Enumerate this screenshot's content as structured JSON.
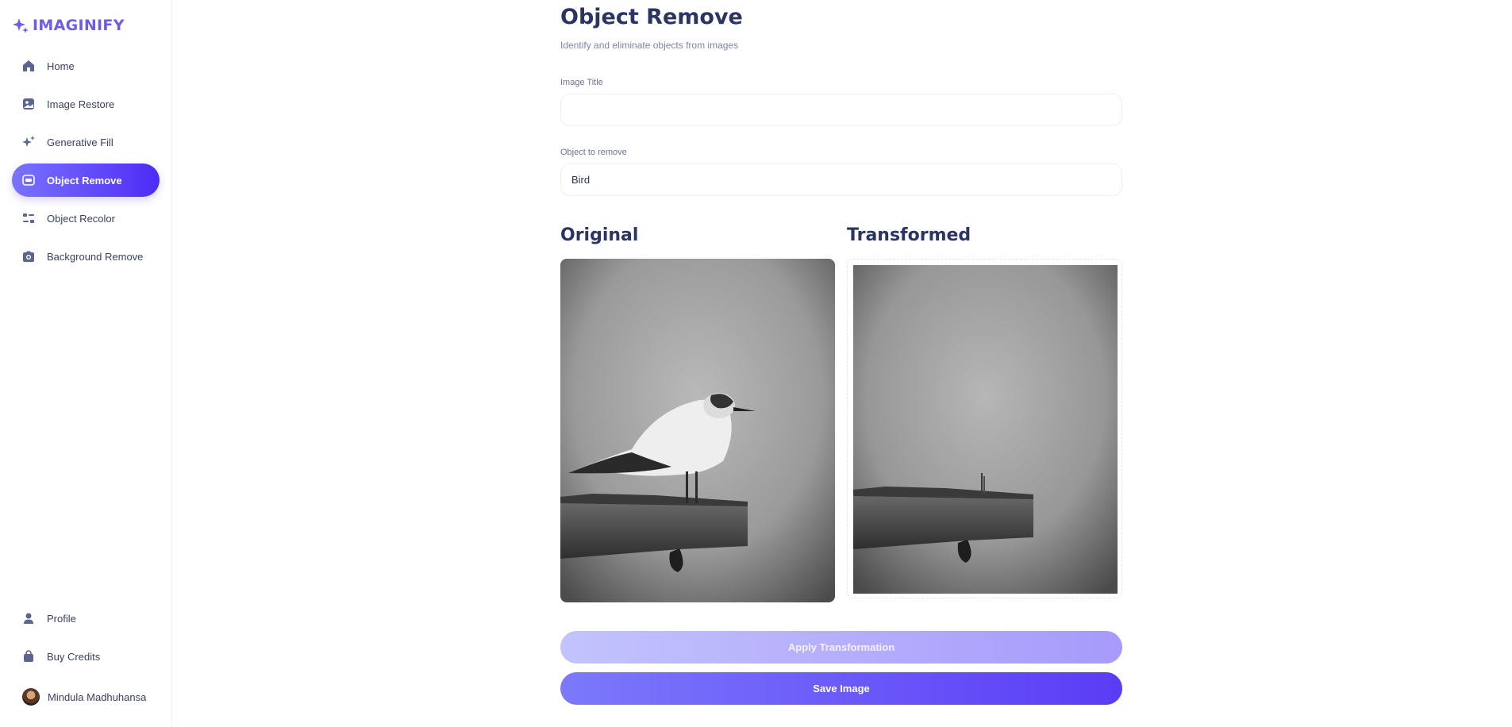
{
  "app": {
    "name": "IMAGINIFY",
    "brand_color": "#6c5ce7"
  },
  "sidebar": {
    "items": [
      {
        "label": "Home",
        "icon": "home-icon"
      },
      {
        "label": "Image Restore",
        "icon": "image-icon"
      },
      {
        "label": "Generative Fill",
        "icon": "sparkles-icon"
      },
      {
        "label": "Object Remove",
        "icon": "scan-icon",
        "active": true
      },
      {
        "label": "Object Recolor",
        "icon": "filter-icon"
      },
      {
        "label": "Background Remove",
        "icon": "camera-icon"
      }
    ],
    "bottom_items": [
      {
        "label": "Profile",
        "icon": "user-icon"
      },
      {
        "label": "Buy Credits",
        "icon": "bag-icon"
      }
    ],
    "user": {
      "name": "Mindula Madhuhansa"
    }
  },
  "page": {
    "title": "Object Remove",
    "subtitle": "Identify and eliminate objects from images"
  },
  "form": {
    "image_title": {
      "label": "Image Title",
      "value": ""
    },
    "object_to_remove": {
      "label": "Object to remove",
      "value": "Bird"
    }
  },
  "images": {
    "original_heading": "Original",
    "transformed_heading": "Transformed"
  },
  "buttons": {
    "apply": "Apply Transformation",
    "save": "Save Image"
  }
}
